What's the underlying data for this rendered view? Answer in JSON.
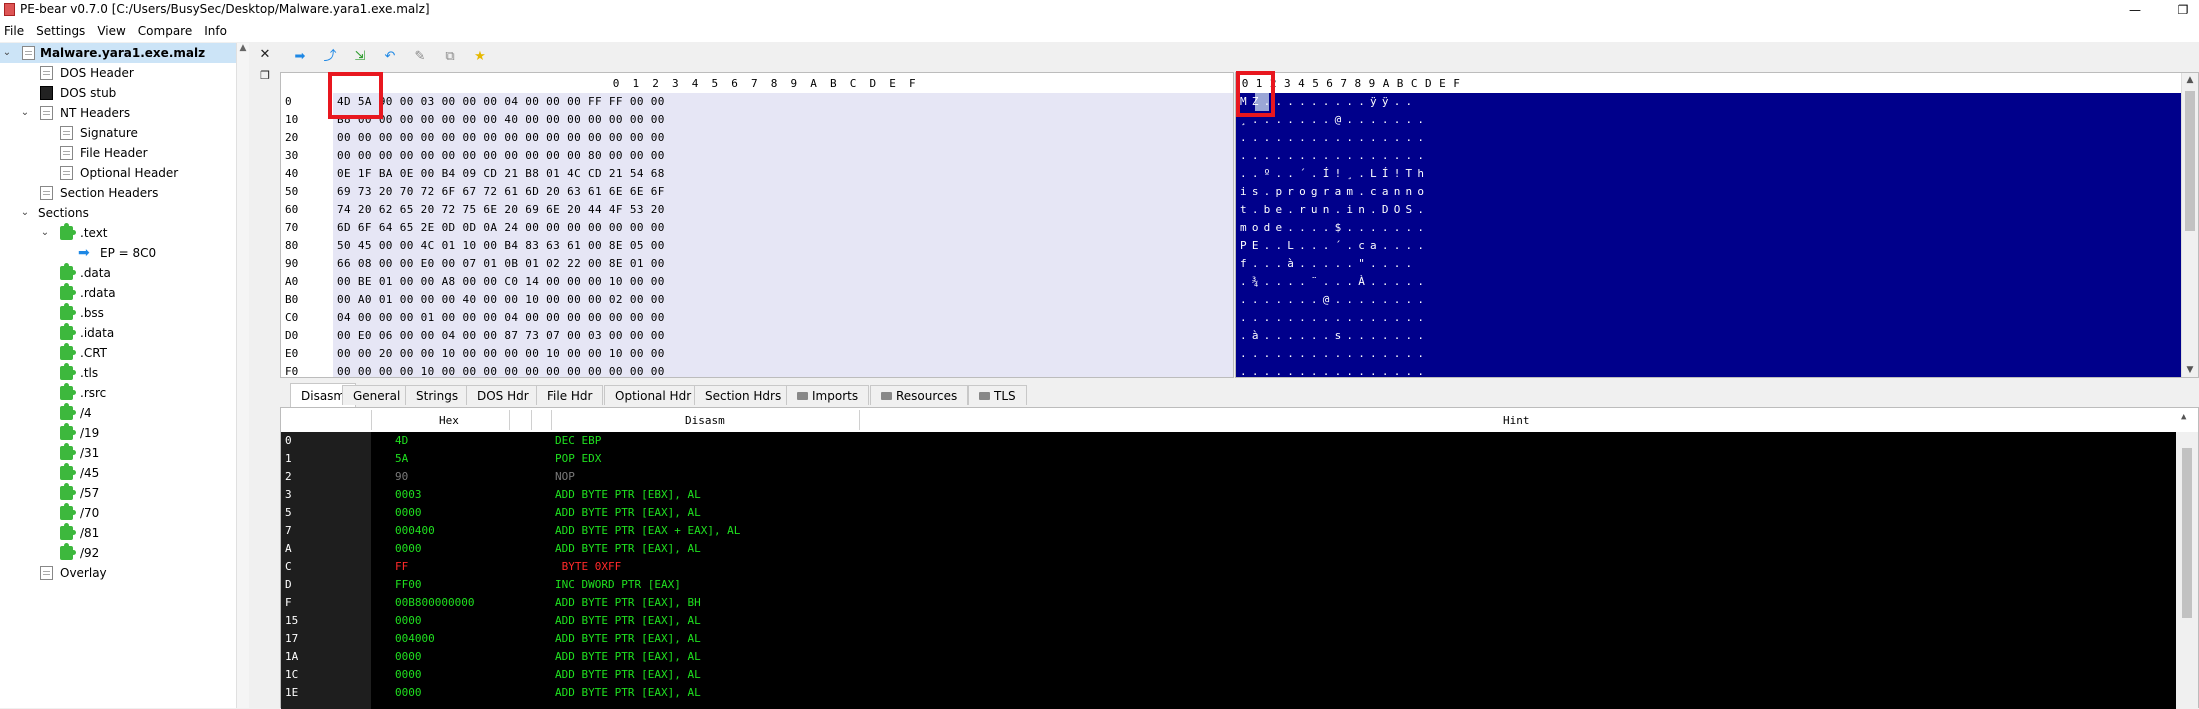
{
  "window": {
    "title": "PE-bear v0.7.0 [C:/Users/BusySec/Desktop/Malware.yara1.exe.malz]"
  },
  "menu": [
    "File",
    "Settings",
    "View",
    "Compare",
    "Info"
  ],
  "tree": {
    "root": "Malware.yara1.exe.malz",
    "items": [
      "DOS Header",
      "DOS stub",
      "NT Headers",
      "Signature",
      "File Header",
      "Optional Header",
      "Section Headers",
      "Sections",
      ".text",
      "EP = 8C0",
      ".data",
      ".rdata",
      ".bss",
      ".idata",
      ".CRT",
      ".tls",
      ".rsrc",
      "/4",
      "/19",
      "/31",
      "/45",
      "/57",
      "/70",
      "/81",
      "/92",
      "Overlay"
    ]
  },
  "hex": {
    "columns": [
      "0",
      "1",
      "2",
      "3",
      "4",
      "5",
      "6",
      "7",
      "8",
      "9",
      "A",
      "B",
      "C",
      "D",
      "E",
      "F"
    ],
    "rows": [
      {
        "addr": "0",
        "bytes": "4D 5A 90 00 03 00 00 00 04 00 00 00 FF FF 00 00"
      },
      {
        "addr": "10",
        "bytes": "B8 00 00 00 00 00 00 00 40 00 00 00 00 00 00 00"
      },
      {
        "addr": "20",
        "bytes": "00 00 00 00 00 00 00 00 00 00 00 00 00 00 00 00"
      },
      {
        "addr": "30",
        "bytes": "00 00 00 00 00 00 00 00 00 00 00 00 80 00 00 00"
      },
      {
        "addr": "40",
        "bytes": "0E 1F BA 0E 00 B4 09 CD 21 B8 01 4C CD 21 54 68"
      },
      {
        "addr": "50",
        "bytes": "69 73 20 70 72 6F 67 72 61 6D 20 63 61 6E 6E 6F"
      },
      {
        "addr": "60",
        "bytes": "74 20 62 65 20 72 75 6E 20 69 6E 20 44 4F 53 20"
      },
      {
        "addr": "70",
        "bytes": "6D 6F 64 65 2E 0D 0D 0A 24 00 00 00 00 00 00 00"
      },
      {
        "addr": "80",
        "bytes": "50 45 00 00 4C 01 10 00 B4 83 63 61 00 8E 05 00"
      },
      {
        "addr": "90",
        "bytes": "66 08 00 00 E0 00 07 01 0B 01 02 22 00 8E 01 00"
      },
      {
        "addr": "A0",
        "bytes": "00 BE 01 00 00 A8 00 00 C0 14 00 00 00 10 00 00"
      },
      {
        "addr": "B0",
        "bytes": "00 A0 01 00 00 00 40 00 00 10 00 00 00 02 00 00"
      },
      {
        "addr": "C0",
        "bytes": "04 00 00 00 01 00 00 00 04 00 00 00 00 00 00 00"
      },
      {
        "addr": "D0",
        "bytes": "00 E0 06 00 00 04 00 00 87 73 07 00 03 00 00 00"
      },
      {
        "addr": "E0",
        "bytes": "00 00 20 00 00 10 00 00 00 00 10 00 00 10 00 00"
      },
      {
        "addr": "F0",
        "bytes": "00 00 00 00 10 00 00 00 00 00 00 00 00 00 00 00"
      }
    ]
  },
  "ascii": {
    "columns": [
      "0",
      "1",
      "2",
      "3",
      "4",
      "5",
      "6",
      "7",
      "8",
      "9",
      "A",
      "B",
      "C",
      "D",
      "E",
      "F"
    ],
    "rows": [
      "MZ.........ÿÿ..",
      "¸.......@.......",
      "................",
      "................",
      "..º..´.Í!¸.LÍ!Th",
      "is.program.canno",
      "t.be.run.in.DOS.",
      "mode....$.......",
      "PE..L...´.ca....",
      "f...à.....\"....",
      ".¾....¨...À.....",
      ".......@........",
      "................",
      ".à......s.......",
      "................",
      "................"
    ]
  },
  "tabs": [
    "Disasm",
    "General",
    "Strings",
    "DOS Hdr",
    "File Hdr",
    "Optional Hdr",
    "Section Hdrs",
    "Imports",
    "Resources",
    "TLS"
  ],
  "disasm": {
    "headers": {
      "hex": "Hex",
      "disasm": "Disasm",
      "hint": "Hint"
    },
    "rows": [
      {
        "addr": "0",
        "hex": "4D",
        "asm": "DEC EBP"
      },
      {
        "addr": "1",
        "hex": "5A",
        "asm": "POP EDX"
      },
      {
        "addr": "2",
        "hex": "90",
        "asm": "NOP"
      },
      {
        "addr": "3",
        "hex": "0003",
        "asm": "ADD BYTE PTR [EBX], AL"
      },
      {
        "addr": "5",
        "hex": "0000",
        "asm": "ADD BYTE PTR [EAX], AL"
      },
      {
        "addr": "7",
        "hex": "000400",
        "asm": "ADD BYTE PTR [EAX + EAX], AL"
      },
      {
        "addr": "A",
        "hex": "0000",
        "asm": "ADD BYTE PTR [EAX], AL"
      },
      {
        "addr": "C",
        "hex": "FF",
        "asm": " BYTE 0XFF"
      },
      {
        "addr": "D",
        "hex": "FF00",
        "asm": "INC DWORD PTR [EAX]"
      },
      {
        "addr": "F",
        "hex": "00B800000000",
        "asm": "ADD BYTE PTR [EAX], BH"
      },
      {
        "addr": "15",
        "hex": "0000",
        "asm": "ADD BYTE PTR [EAX], AL"
      },
      {
        "addr": "17",
        "hex": "004000",
        "asm": "ADD BYTE PTR [EAX], AL"
      },
      {
        "addr": "1A",
        "hex": "0000",
        "asm": "ADD BYTE PTR [EAX], AL"
      },
      {
        "addr": "1C",
        "hex": "0000",
        "asm": "ADD BYTE PTR [EAX], AL"
      },
      {
        "addr": "1E",
        "hex": "0000",
        "asm": "ADD BYTE PTR [EAX], AL"
      }
    ]
  },
  "colors": {
    "ascii_bg": "#00008b",
    "disasm_text": "#1fe01f",
    "highlight": "#e8171f"
  }
}
